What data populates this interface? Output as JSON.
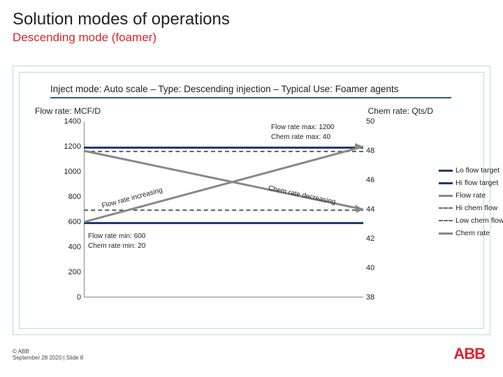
{
  "title": "Solution modes of operations",
  "subtitle": "Descending mode (foamer)",
  "caption": "Inject mode: Auto scale – Type: Descending injection – Typical Use: Foamer agents",
  "left_axis_title": "Flow rate: MCF/D",
  "right_axis_title": "Chem rate: Qts/D",
  "left_ticks": {
    "t0": "1400",
    "t1": "1200",
    "t2": "1000",
    "t3": "800",
    "t4": "600",
    "t5": "400",
    "t6": "200",
    "t7": "0"
  },
  "right_ticks": {
    "t0": "50",
    "t1": "48",
    "t2": "46",
    "t3": "44",
    "t4": "42",
    "t5": "40",
    "t6": "38"
  },
  "annotations": {
    "flow_max": "Flow rate max: 1200",
    "chem_max": "Chem rate max: 40",
    "flow_min": "Flow rate min: 600",
    "chem_min": "Chem rate min: 20",
    "flow_inc": "Flow rate increasing",
    "chem_dec": "Chem rate decreasing"
  },
  "legend": {
    "lo": "Lo flow target",
    "hi": "Hi flow target",
    "flow": "Flow rate",
    "hichem": "Hi chem flow",
    "lochem": "Low chem flow",
    "chem": "Chem rate"
  },
  "footer": {
    "l1": "© ABB",
    "l2": "September 28 2020 | Slide 8"
  },
  "logo": "ABB",
  "chart_data": {
    "type": "line",
    "title": "Descending mode (foamer)",
    "left_axis": {
      "label": "Flow rate: MCF/D",
      "min": 0,
      "max": 1400,
      "ticks": [
        0,
        200,
        400,
        600,
        800,
        1000,
        1200,
        1400
      ]
    },
    "right_axis": {
      "label": "Chem rate: Qts/D",
      "min": 38,
      "max": 50,
      "ticks": [
        38,
        40,
        42,
        44,
        46,
        48,
        50
      ]
    },
    "series": [
      {
        "name": "Hi flow target",
        "axis": "left",
        "style": "solid-navy",
        "values": [
          1200,
          1200
        ]
      },
      {
        "name": "Lo flow target",
        "axis": "left",
        "style": "solid-navy",
        "values": [
          600,
          600
        ]
      },
      {
        "name": "Flow rate",
        "axis": "left",
        "style": "solid-gray",
        "values": [
          600,
          1200
        ]
      },
      {
        "name": "Hi chem flow",
        "axis": "right",
        "style": "dashed",
        "values": [
          48,
          48
        ]
      },
      {
        "name": "Low chem flow",
        "axis": "right",
        "style": "dashed",
        "values": [
          44,
          44
        ]
      },
      {
        "name": "Chem rate",
        "axis": "right",
        "style": "solid-gray",
        "values": [
          48,
          44
        ]
      }
    ],
    "annotations": [
      "Flow rate max: 1200",
      "Chem rate max: 40",
      "Flow rate min: 600",
      "Chem rate min: 20",
      "Flow rate increasing",
      "Chem rate decreasing"
    ]
  }
}
